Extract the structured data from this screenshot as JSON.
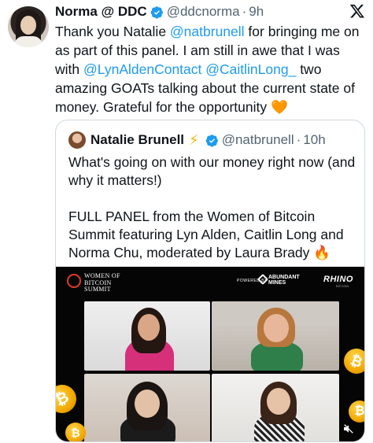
{
  "tweet": {
    "author_name": "Norma @ DDC",
    "handle": "@ddcnorma",
    "time": "9h",
    "text_1": "Thank you Natalie ",
    "mention_1": "@natbrunell",
    "text_2": " for bringing me on as part of this panel. I am still in awe that I was with ",
    "mention_2": "@LynAldenContact",
    "text_3": " ",
    "mention_3": "@CaitlinLong_",
    "text_4": " two amazing GOATs talking about the current state of money. Grateful for the opportunity ",
    "emoji": "🧡"
  },
  "quote": {
    "author_name": "Natalie Brunell",
    "bolt": "⚡",
    "handle": "@natbrunell",
    "time": "10h",
    "para_1": "What's going on with our money right now (and why it matters!)",
    "para_2": "FULL PANEL from the Women of Bitcoin Summit featuring Lyn Alden, Caitlin Long and Norma Chu, moderated by Laura Brady ",
    "emoji": "🔥"
  },
  "media": {
    "logo_line_1": "WOMEN OF",
    "logo_line_2": "BITCOIN",
    "logo_line_3": "SUMMIT",
    "powered_by": "POWERED BY",
    "sponsor_1_line_1": "ABUNDANT",
    "sponsor_1_line_2": "MINES",
    "sponsor_2": "RHINO",
    "sponsor_2_sub": "BITCOIN"
  },
  "colors": {
    "link": "#1d9bf0",
    "verified": "#1d9bf0",
    "secondary_text": "#536471"
  },
  "icons": [
    "verified-badge-icon",
    "x-logo-icon",
    "lightning-bolt-icon",
    "mute-icon",
    "bitcoin-coin-icon"
  ]
}
